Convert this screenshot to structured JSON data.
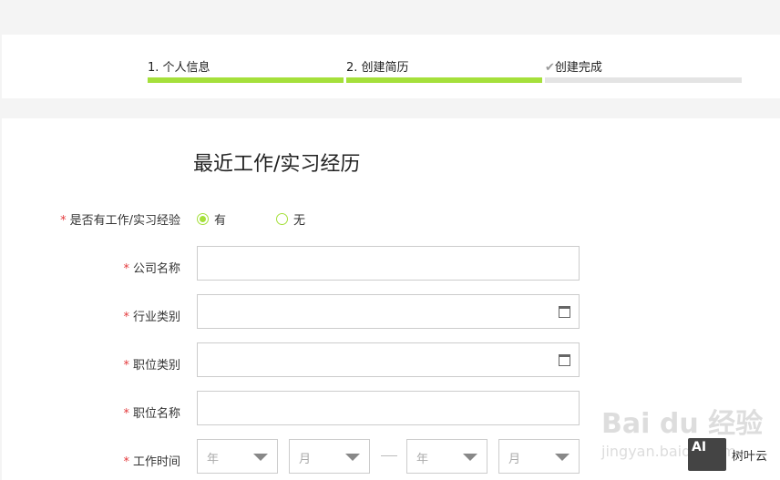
{
  "steps": [
    {
      "label": "1. 个人信息",
      "done": true
    },
    {
      "label": "2. 创建简历",
      "done": true
    },
    {
      "label": "创建完成",
      "done": false
    }
  ],
  "colors": {
    "accent": "#a5e03b",
    "inactive": "#e4e4e4",
    "required": "#e4393c"
  },
  "form": {
    "title": "最近工作/实习经历",
    "required_mark": "*",
    "experience": {
      "label": "是否有工作/实习经验",
      "options": [
        "有",
        "无"
      ],
      "selected": "有"
    },
    "company": {
      "label": "公司名称",
      "value": ""
    },
    "industry": {
      "label": "行业类别",
      "value": ""
    },
    "position_type": {
      "label": "职位类别",
      "value": ""
    },
    "position_name": {
      "label": "职位名称",
      "value": ""
    },
    "work_time": {
      "label": "工作时间",
      "start_year": "年",
      "start_month": "月",
      "end_year": "年",
      "end_month": "月"
    }
  },
  "watermark": {
    "baidu": "Bai du 经验",
    "url": "jingyan.baidu.com",
    "logo": "AI",
    "brand": "树叶云"
  }
}
